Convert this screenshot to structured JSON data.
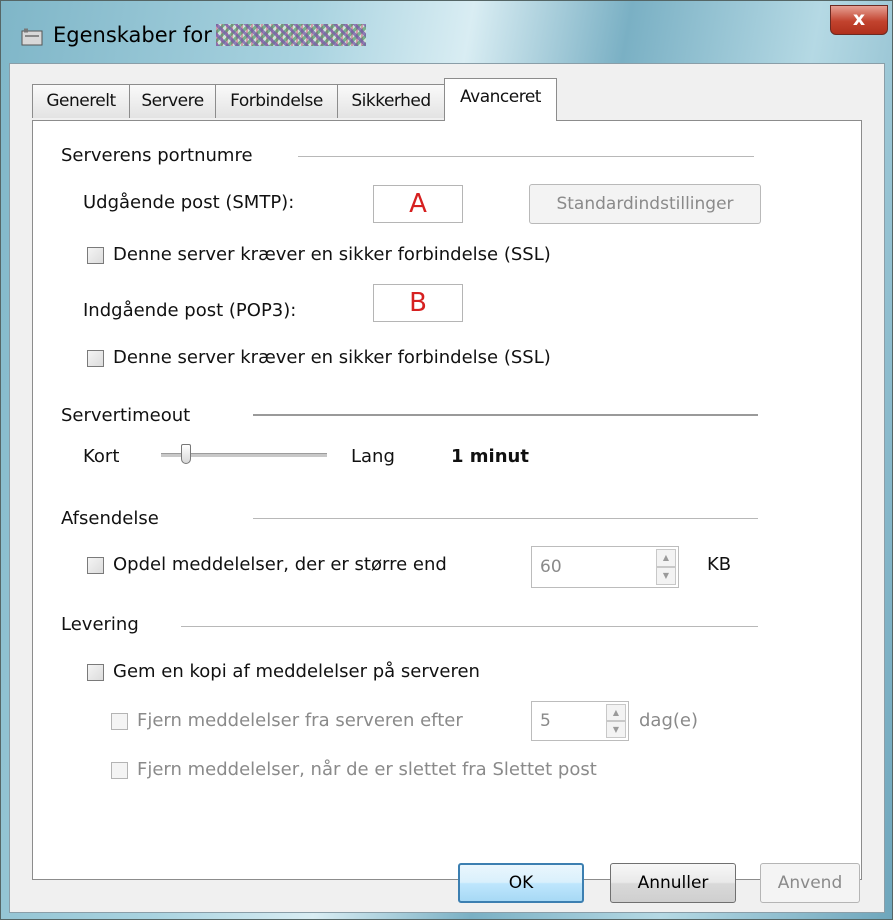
{
  "window": {
    "title": "Egenskaber for",
    "close_label": "x"
  },
  "tabs": [
    {
      "label": "Generelt"
    },
    {
      "label": "Servere"
    },
    {
      "label": "Forbindelse"
    },
    {
      "label": "Sikkerhed"
    },
    {
      "label": "Avanceret"
    }
  ],
  "active_tab": "Avanceret",
  "ports": {
    "group_label": "Serverens portnumre",
    "smtp_label": "Udgående post (SMTP):",
    "smtp_value": "A",
    "smtp_ssl_label": "Denne server kræver en sikker forbindelse (SSL)",
    "smtp_ssl_checked": false,
    "pop3_label": "Indgående post (POP3):",
    "pop3_value": "B",
    "pop3_ssl_label": "Denne server kræver en sikker forbindelse (SSL)",
    "pop3_ssl_checked": false,
    "defaults_button": "Standardindstillinger"
  },
  "timeout": {
    "group_label": "Servertimeout",
    "short_label": "Kort",
    "long_label": "Lang",
    "value_label": "1 minut",
    "slider_level": 0.13
  },
  "sending": {
    "group_label": "Afsendelse",
    "split_label": "Opdel meddelelser, der er større end",
    "split_checked": false,
    "split_value": "60",
    "unit": "KB"
  },
  "delivery": {
    "group_label": "Levering",
    "keep_copy_label": "Gem en kopi af meddelelser på serveren",
    "keep_copy_checked": false,
    "remove_after_label": "Fjern meddelelser fra serveren efter",
    "remove_after_value": "5",
    "remove_after_unit": "dag(e)",
    "remove_deleted_label": "Fjern meddelelser, når de er slettet fra Slettet post"
  },
  "buttons": {
    "ok": "OK",
    "cancel": "Annuller",
    "apply": "Anvend"
  },
  "colors": {
    "port_text": "#d62020",
    "disabled_text": "#8a8a8a",
    "close_button": "#c2432e"
  }
}
